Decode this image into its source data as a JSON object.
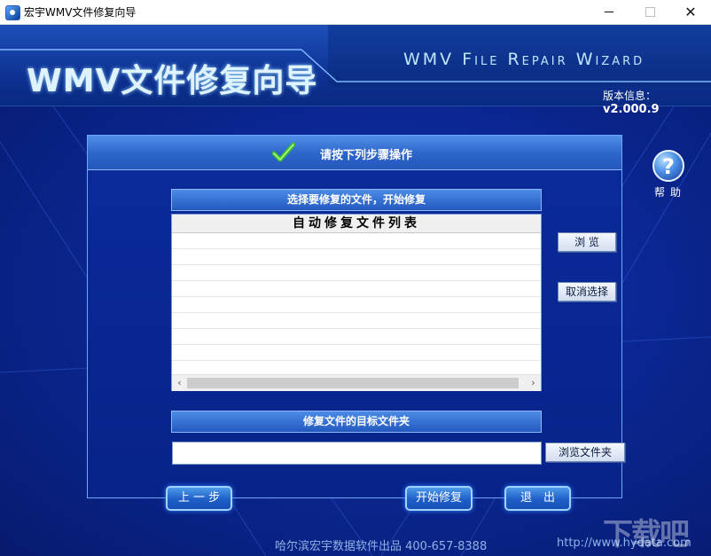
{
  "window": {
    "title": "宏宇WMV文件修复向导",
    "controls": {
      "minimize": "—",
      "maximize": "□",
      "close": "✕"
    }
  },
  "header": {
    "logo_text": "WMV文件修复向导",
    "english_title": "WMV File Repair Wizard",
    "version_label": "版本信息：",
    "version_value": "v2.000.9"
  },
  "panel": {
    "title": "请按下列步骤操作",
    "file_section_title": "选择要修复的文件，开始修复",
    "list_header": "自动修复文件列表",
    "list_rows": [
      "",
      "",
      "",
      "",
      "",
      "",
      "",
      "",
      ""
    ],
    "target_section_title": "修复文件的目标文件夹",
    "target_path": ""
  },
  "buttons": {
    "browse": "浏 览",
    "cancel_select": "取消选择",
    "browse_folder": "浏览文件夹",
    "prev": "上 一 步",
    "start_repair": "开始修复",
    "exit": "退　出"
  },
  "help": {
    "symbol": "?",
    "label": "帮助"
  },
  "footer": {
    "company": "哈尔滨宏宇数据软件出品  400-657-8388",
    "url": "http://www.hydata.com"
  },
  "watermark": "下载吧",
  "colors": {
    "background": "#0b2794",
    "accent": "#2c64c8",
    "check_green": "#3fbf2f"
  }
}
